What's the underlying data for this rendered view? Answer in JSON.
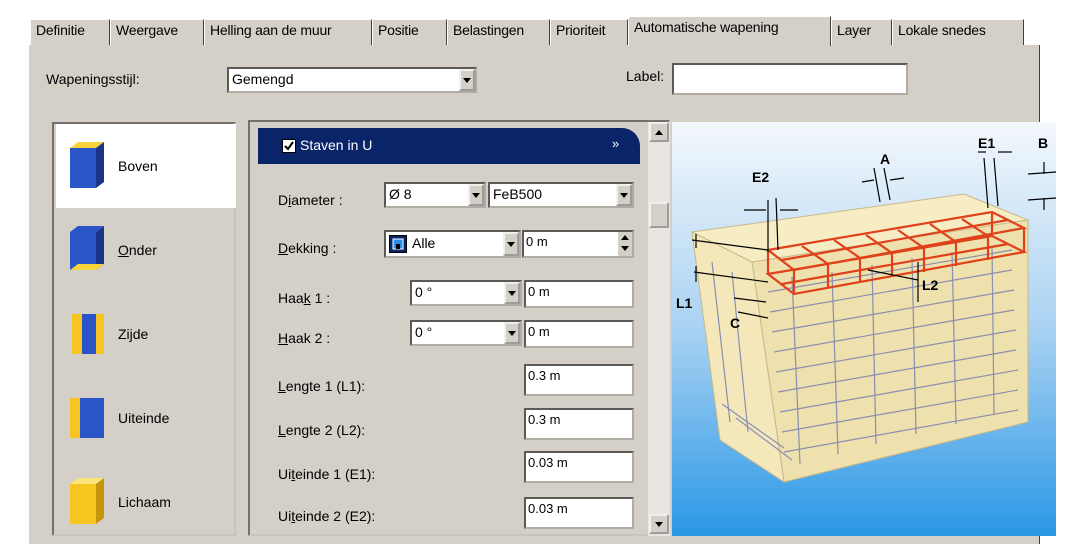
{
  "tabs": [
    "Definitie",
    "Weergave",
    "Helling aan de muur",
    "Positie",
    "Belastingen",
    "Prioriteit",
    "Automatische wapening",
    "Layer",
    "Lokale snedes"
  ],
  "active_tab": "Automatische wapening",
  "style": {
    "label": "Wapeningsstijl:",
    "value": "Gemengd"
  },
  "label_field": {
    "label": "Label:",
    "value": ""
  },
  "side_items": [
    {
      "label": "Boven",
      "icon": "top-face-icon",
      "selected": true
    },
    {
      "label": "Onder",
      "icon": "bottom-face-icon",
      "selected": false
    },
    {
      "label": "Zijde",
      "icon": "side-face-icon",
      "selected": false
    },
    {
      "label": "Uiteinde",
      "icon": "end-face-icon",
      "selected": false
    },
    {
      "label": "Lichaam",
      "icon": "body-icon",
      "selected": false
    }
  ],
  "section": {
    "title": "Staven in U",
    "checked": true
  },
  "form": {
    "diameter": {
      "label": "Diameter :",
      "size": "Ø 8",
      "grade": "FeB500"
    },
    "cover": {
      "label": "Dekking :",
      "mode": "Alle",
      "value": "0 m"
    },
    "hook1": {
      "label": "Haak 1 :",
      "angle": "0 °",
      "value": "0 m"
    },
    "hook2": {
      "label": "Haak 2 :",
      "angle": "0 °",
      "value": "0 m"
    },
    "length1": {
      "label": "Lengte 1 (L1):",
      "value": "0.3 m"
    },
    "length2": {
      "label": "Lengte 2 (L2):",
      "value": "0.3 m"
    },
    "end1": {
      "label": "Uiteinde 1 (E1):",
      "value": "0.03 m"
    },
    "end2": {
      "label": "Uiteinde 2 (E2):",
      "value": "0.03 m"
    }
  },
  "diagram": {
    "labels": {
      "E1": "E1",
      "B": "B",
      "A": "A",
      "E2": "E2",
      "L2": "L2",
      "L1": "L1",
      "C": "C"
    }
  },
  "colors": {
    "header": "#0a246a",
    "panel": "#d4d0c8",
    "rebar_red": "#e0401a",
    "sky_top": "#e8f2fb",
    "sky_bottom": "#3aa0e6"
  }
}
